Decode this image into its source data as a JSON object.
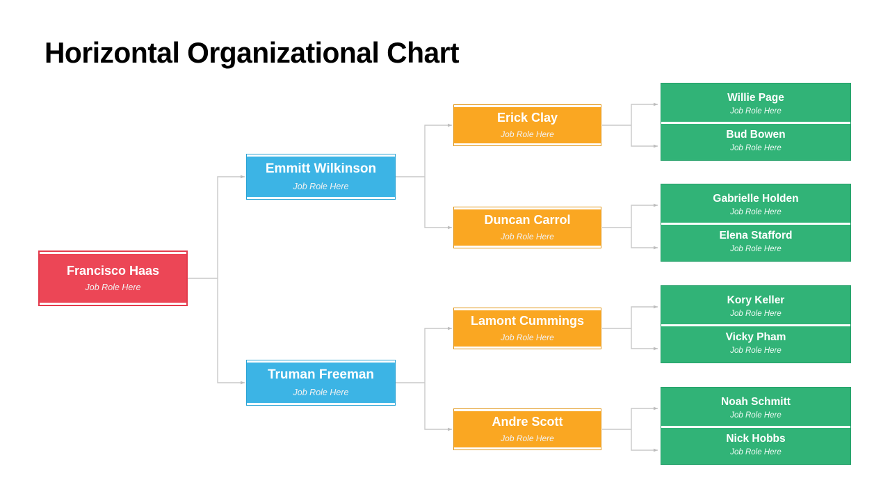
{
  "page": {
    "title": "Horizontal Organizational Chart",
    "background": "#FFFFFF"
  },
  "colors": {
    "root": "#EC4656",
    "level2": "#3CB4E5",
    "level3": "#FAA722",
    "level4": "#31B377",
    "connector": "#C8C8C8",
    "node_text": "#FFFFFF",
    "title_text": "#000000"
  },
  "chart_data": {
    "type": "diagram",
    "title": "Horizontal Organizational Chart",
    "orientation": "horizontal",
    "levels": 4
  },
  "org": {
    "root": {
      "name": "Francisco Haas",
      "role": "Job Role Here"
    },
    "level2": [
      {
        "name": "Emmitt Wilkinson",
        "role": "Job Role Here"
      },
      {
        "name": "Truman Freeman",
        "role": "Job Role Here"
      }
    ],
    "level3": [
      {
        "name": "Erick Clay",
        "role": "Job Role Here"
      },
      {
        "name": "Duncan Carrol",
        "role": "Job Role Here"
      },
      {
        "name": "Lamont Cummings",
        "role": "Job Role Here"
      },
      {
        "name": "Andre Scott",
        "role": "Job Role Here"
      }
    ],
    "level4": [
      {
        "members": [
          {
            "name": "Willie Page",
            "role": "Job Role Here"
          },
          {
            "name": "Bud Bowen",
            "role": "Job Role Here"
          }
        ]
      },
      {
        "members": [
          {
            "name": "Gabrielle Holden",
            "role": "Job Role Here"
          },
          {
            "name": "Elena Stafford",
            "role": "Job Role Here"
          }
        ]
      },
      {
        "members": [
          {
            "name": "Kory Keller",
            "role": "Job Role Here"
          },
          {
            "name": "Vicky Pham",
            "role": "Job Role Here"
          }
        ]
      },
      {
        "members": [
          {
            "name": "Noah Schmitt",
            "role": "Job Role Here"
          },
          {
            "name": "Nick Hobbs",
            "role": "Job Role Here"
          }
        ]
      }
    ]
  }
}
